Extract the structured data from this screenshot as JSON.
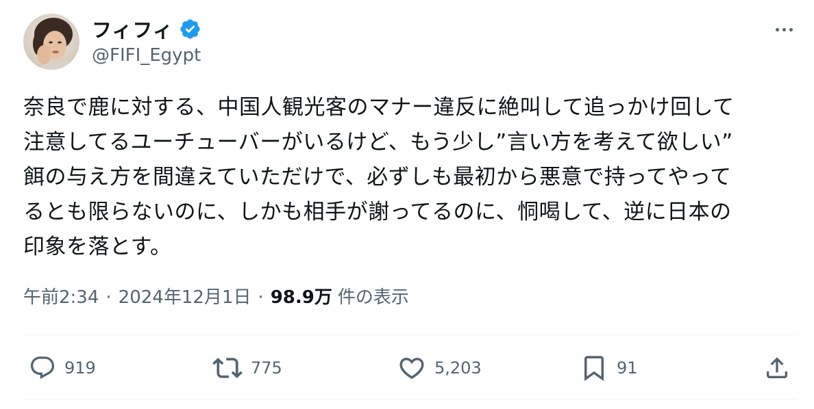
{
  "author": {
    "display_name": "フィフィ",
    "handle": "@FIFI_Egypt",
    "verified": true
  },
  "tweet": {
    "text": "奈良で鹿に対する、中国人観光客のマナー違反に絶叫して追っかけ回して\n注意してるユーチューバーがいるけど、もう少し”言い方を考えて欲しい”\n餌の与え方を間違えていただけで、必ずしも最初から悪意で持ってやって\nるとも限らないのに、しかも相手が謝ってるのに、恫喝して、逆に日本の\n印象を落とす。"
  },
  "meta": {
    "time": "午前2:34",
    "date": "2024年12月1日",
    "separator": "·",
    "views_count": "98.9万",
    "views_label": "件の表示"
  },
  "actions": {
    "replies": "919",
    "retweets": "775",
    "likes": "5,203",
    "bookmarks": "91"
  },
  "colors": {
    "text": "#0f1419",
    "secondary": "#536471",
    "verified": "#1d9bf0",
    "divider": "#eff3f4"
  },
  "icons": {
    "more": "more-horizontal-icon",
    "reply": "reply-icon",
    "retweet": "retweet-icon",
    "like": "heart-icon",
    "bookmark": "bookmark-icon",
    "share": "share-icon"
  }
}
